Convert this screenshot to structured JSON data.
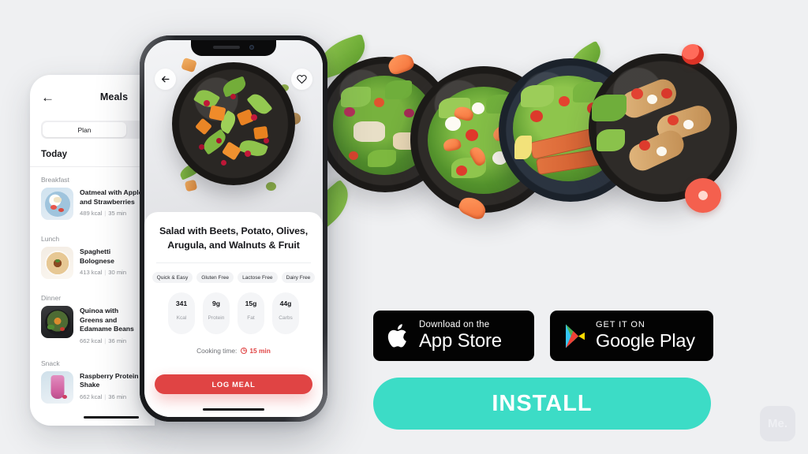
{
  "background_color": "#eff0f2",
  "left_phone": {
    "header": {
      "back_icon": "back-arrow-icon",
      "title": "Meals"
    },
    "segment": {
      "active_label": "Plan"
    },
    "today_label": "Today",
    "groups": [
      {
        "label": "Breakfast",
        "meals": [
          {
            "name": "Oatmeal with Apple and Strawberries",
            "kcal": "489 kcal",
            "time": "35 min"
          }
        ]
      },
      {
        "label": "Lunch",
        "meals": [
          {
            "name": "Spaghetti Bolognese",
            "kcal": "413 kcal",
            "time": "30 min"
          }
        ]
      },
      {
        "label": "Dinner",
        "meals": [
          {
            "name": "Quinoa with Greens and Edamame Beans",
            "kcal": "662 kcal",
            "time": "36 min"
          }
        ]
      },
      {
        "label": "Snack",
        "meals": [
          {
            "name": "Raspberry Protein Shake",
            "kcal": "662 kcal",
            "time": "36 min"
          }
        ]
      }
    ]
  },
  "main_phone": {
    "back_icon": "back-arrow-icon",
    "favorite_icon": "heart-outline-icon",
    "dish_title": "Salad with Beets, Potato, Olives, Arugula, and Walnuts & Fruit",
    "tags": [
      "Quick & Easy",
      "Gluten Free",
      "Lactose Free",
      "Dairy Free"
    ],
    "nutrition": [
      {
        "value": "341",
        "label": "Kcal"
      },
      {
        "value": "9g",
        "label": "Protein"
      },
      {
        "value": "15g",
        "label": "Fat"
      },
      {
        "value": "44g",
        "label": "Carbs"
      }
    ],
    "cooking_time_label": "Cooking time:",
    "cooking_time_value": "15 min",
    "cooking_time_icon": "clock-icon",
    "cta_label": "LOG MEAL",
    "cta_color": "#e04444"
  },
  "badges": {
    "apple": {
      "icon": "apple-logo-icon",
      "small": "Download on the",
      "big": "App Store"
    },
    "google": {
      "icon": "google-play-logo-icon",
      "small": "GET IT ON",
      "big": "Google Play"
    }
  },
  "install": {
    "label": "INSTALL",
    "color": "#3cdcc6"
  },
  "logo": {
    "text": "Me."
  }
}
